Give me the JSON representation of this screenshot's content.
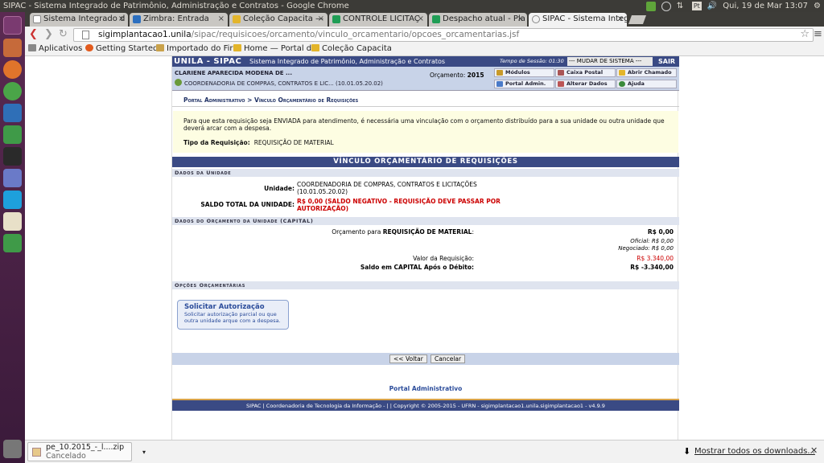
{
  "window": {
    "title": "SIPAC - Sistema Integrado de Patrimônio, Administração e Contratos - Google Chrome",
    "clock": "Qui, 19 de Mar 13:07",
    "lang": "Pt"
  },
  "tabs": [
    {
      "label": "Sistema Integrado d",
      "color": "#ffffff"
    },
    {
      "label": "Zimbra: Entrada",
      "color": "#2c6fbf"
    },
    {
      "label": "Coleção Capacita —",
      "color": "#e3b52b"
    },
    {
      "label": "CONTROLE LICITAÇ",
      "color": "#1f9d55"
    },
    {
      "label": "Despacho atual - Pla",
      "color": "#1f9d55"
    },
    {
      "label": "SIPAC - Sistema Integ",
      "color": "#cccccc"
    }
  ],
  "address": {
    "host": "sigimplantacao1.unila",
    "path": "/sipac/requisicoes/orcamento/vinculo_orcamentario/opcoes_orcamentarias.jsf"
  },
  "bookmarks": [
    {
      "label": "Aplicativos",
      "color": "#666"
    },
    {
      "label": "Getting Started",
      "color": "#e25b1e"
    },
    {
      "label": "Importado do Fir",
      "color": "#c9a24b"
    },
    {
      "label": "Home — Portal d",
      "color": "#e3b52b"
    },
    {
      "label": "Coleção Capacita",
      "color": "#e3b52b"
    }
  ],
  "sipac": {
    "brand": "UNILA - SIPAC",
    "subtitle": "Sistema Integrado de Patrimônio, Administração e Contratos",
    "session_label": "Tempo de Sessão: 01:30",
    "mudar": "--- MUDAR DE SISTEMA ---",
    "sair": "SAIR",
    "user_name": "CLARIENE APARECIDA MODENA DE ...",
    "user_unit": "COORDENADORIA DE COMPRAS, CONTRATOS E LIC... (10.01.05.20.02)",
    "orcamento_label": "Orçamento:",
    "orcamento_year": "2015",
    "quick": {
      "modulos": "Módulos",
      "caixa": "Caixa Postal",
      "chamado": "Abrir Chamado",
      "portal": "Portal Admin.",
      "alterar": "Alterar Dados",
      "ajuda": "Ajuda"
    },
    "breadcrumb": "Portal Administrativo > Vínculo Orçamentário de Requisições",
    "notice": "Para que esta requisição seja ENVIADA para atendimento, é necessária uma vinculação com o orçamento distribuído para a sua unidade ou outra unidade que deverá arcar com a despesa.",
    "tipo_label": "Tipo da Requisição:",
    "tipo_value": "REQUISIÇÃO DE MATERIAL",
    "section_title": "VÍNCULO ORÇAMENTÁRIO DE REQUISIÇÕES",
    "dados_unidade": "Dados da Unidade",
    "unidade_label": "Unidade:",
    "unidade_value": "COORDENADORIA DE COMPRAS, CONTRATOS E LICITAÇÕES",
    "unidade_code": "(10.01.05.20.02)",
    "saldo_label": "SALDO TOTAL DA UNIDADE:",
    "saldo_value": "R$ 0,00 (SALDO NEGATIVO - REQUISIÇÃO DEVE PASSAR POR",
    "saldo_value2": "AUTORIZAÇÃO)",
    "dados_orcamento": "Dados do Orçamento da Unidade (CAPITAL)",
    "orc_para": "Orçamento para",
    "orc_para_bold": "REQUISIÇÃO DE MATERIAL",
    "orc_para_value": "R$ 0,00",
    "oficial": "Oficial: R$ 0,00",
    "negociado": "Negociado: R$ 0,00",
    "valor_req_label": "Valor da Requisição:",
    "valor_req_value": "R$ 3.340,00",
    "saldo_cap_label": "Saldo em CAPITAL Após o Débito:",
    "saldo_cap_value": "R$ -3.340,00",
    "opcoes": "Opções Orçamentárias",
    "sol_title": "Solicitar Autorização",
    "sol_desc": "Solicitar autorização parcial ou que outra unidade arque com a despesa.",
    "voltar": "<< Voltar",
    "cancelar": "Cancelar",
    "footer_link": "Portal Administrativo",
    "footer": "SIPAC | Coordenadoria de Tecnologia da Informação - | | Copyright © 2005-2015 - UFRN - sigimplantacao1.unila.sigimplantacao1 - v4.9.9"
  },
  "download": {
    "file": "pe_10.2015_-_l....zip",
    "status": "Cancelado",
    "show_all": "Mostrar todos os downloads...",
    "close": "✕"
  }
}
